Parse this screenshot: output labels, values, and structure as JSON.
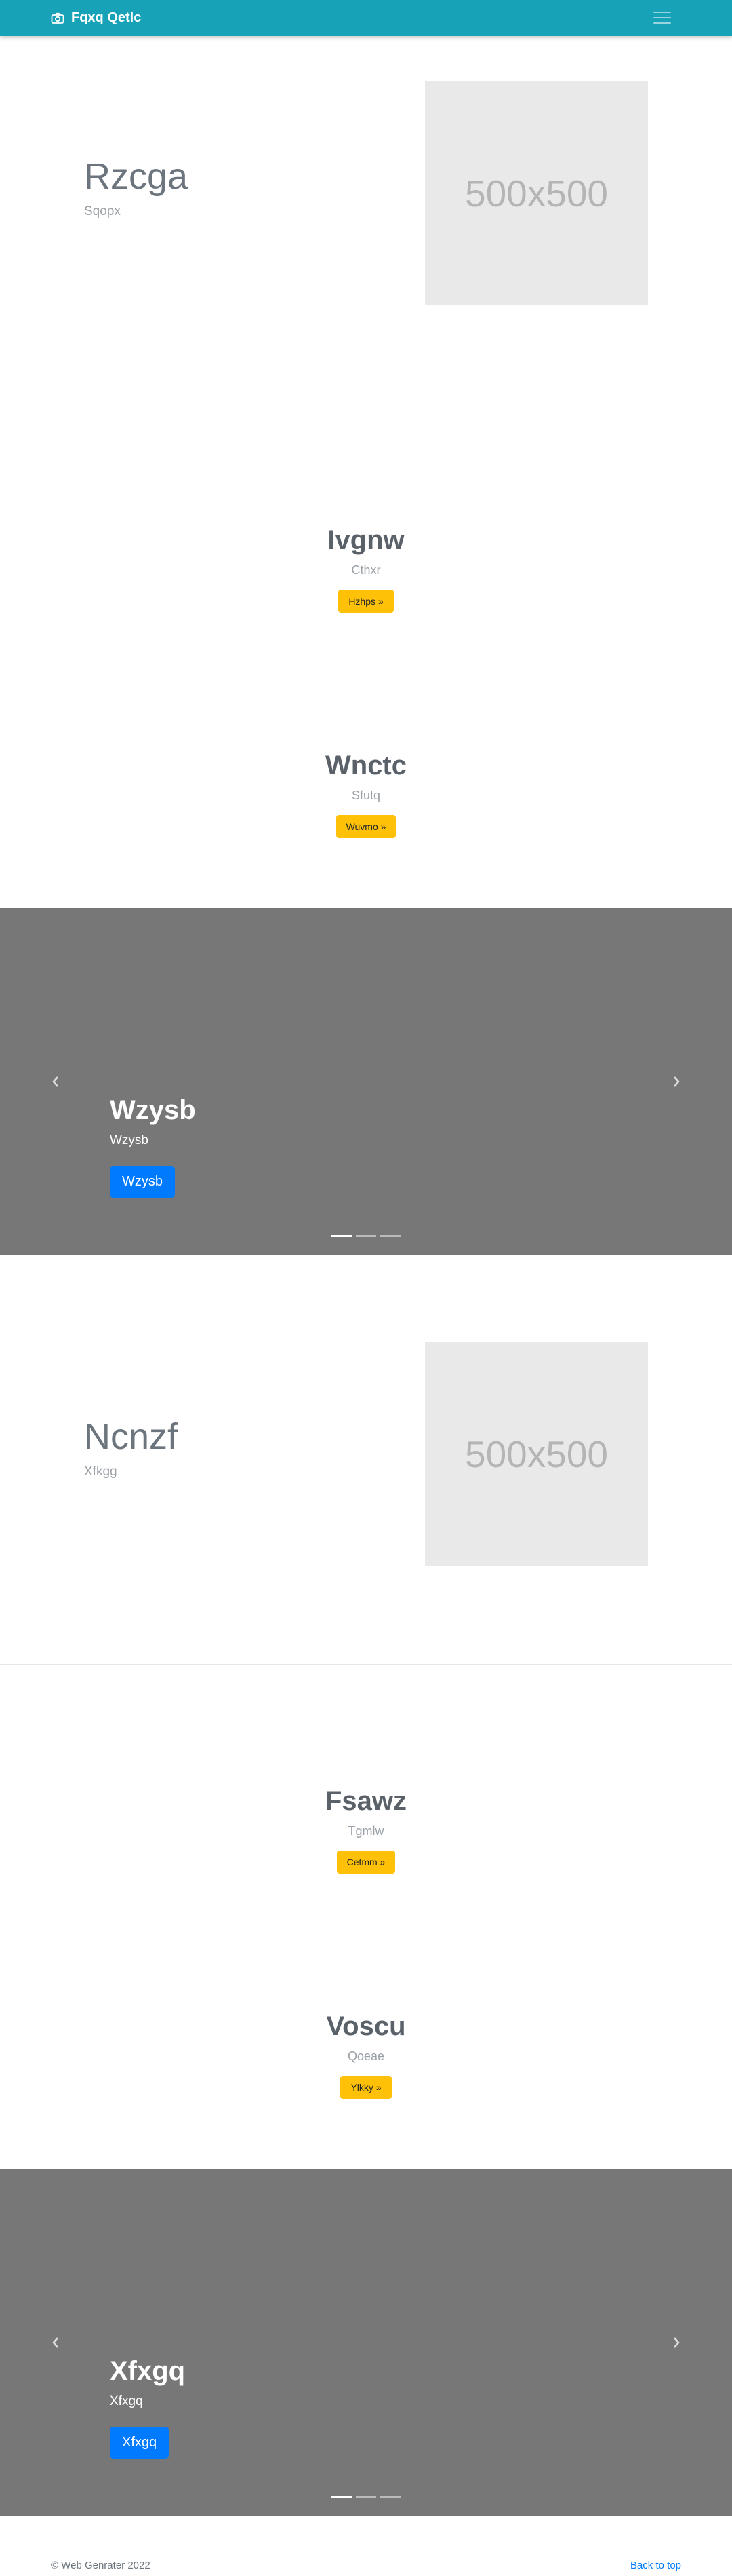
{
  "navbar": {
    "brand": "Fqxq Qetlc",
    "brand_icon": "camera-icon",
    "toggler_icon": "hamburger-menu-icon"
  },
  "sections": {
    "hero1": {
      "title": "Rzcga",
      "subtitle": "Sqopx",
      "image_label": "500x500"
    },
    "feature1": {
      "title": "Ivgnw",
      "subtitle": "Cthxr",
      "button": "Hzhps »"
    },
    "feature2": {
      "title": "Wnctc",
      "subtitle": "Sfutq",
      "button": "Wuvmo »"
    },
    "carousel1": {
      "title": "Wzysb",
      "subtitle": "Wzysb",
      "button": "Wzysb",
      "active_index": 0,
      "slides": 3
    },
    "hero2": {
      "title": "Ncnzf",
      "subtitle": "Xfkgg",
      "image_label": "500x500"
    },
    "feature3": {
      "title": "Fsawz",
      "subtitle": "Tgmlw",
      "button": "Cetmm »"
    },
    "feature4": {
      "title": "Voscu",
      "subtitle": "Qoeae",
      "button": "Ylkky »"
    },
    "carousel2": {
      "title": "Xfxgq",
      "subtitle": "Xfxgq",
      "button": "Xfxgq",
      "active_index": 0,
      "slides": 3
    }
  },
  "footer": {
    "copyright": "© Web Genrater 2022",
    "back_to_top": "Back to top"
  },
  "colors": {
    "navbar": "#17a2b8",
    "warning": "#ffc107",
    "primary": "#007bff",
    "carousel_bg": "#777777",
    "placeholder_bg": "#e9e9e9"
  }
}
